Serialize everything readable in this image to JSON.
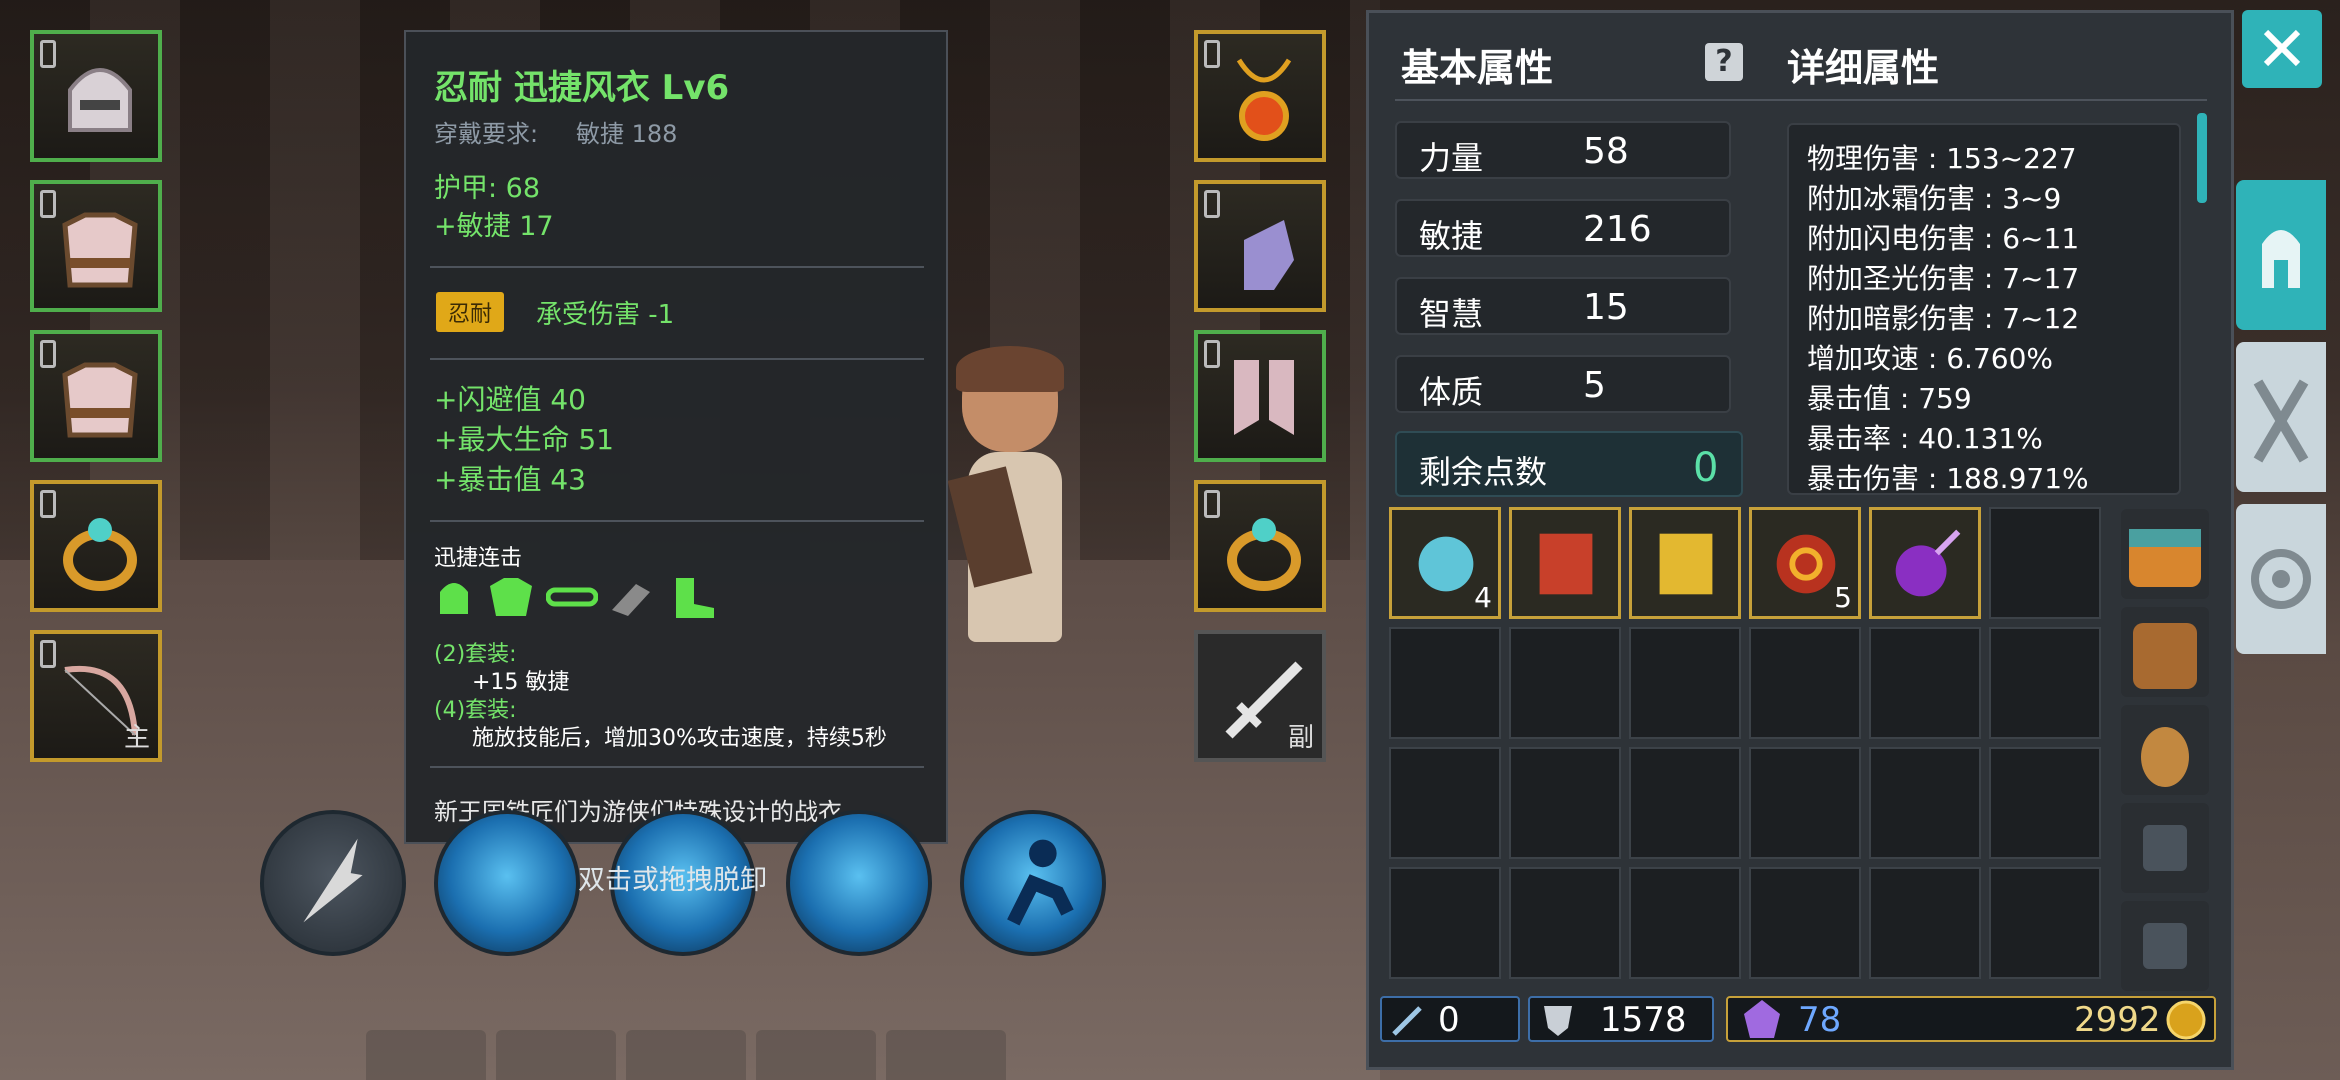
{
  "tooltip": {
    "title": "忍耐 迅捷风衣 Lv6",
    "requirement_label": "穿戴要求:",
    "requirement_value": "敏捷 188",
    "armor": "护甲:  68",
    "agility_bonus": "+敏捷 17",
    "trait_tag": "忍耐",
    "trait_text": "承受伤害 -1",
    "bonuses": [
      "+闪避值 40",
      "+最大生命 51",
      "+暴击值 43"
    ],
    "set_name": "迅捷连击",
    "set2_label": "(2)套装:",
    "set2_text": "+15 敏捷",
    "set4_label": "(4)套装:",
    "set4_text": "施放技能后，增加30%攻击速度，持续5秒",
    "description": "新王国铁匠们为游侠们特殊设计的战衣。"
  },
  "equip_left": [
    {
      "name": "helmet",
      "icon": "helmet-icon"
    },
    {
      "name": "armor",
      "icon": "chest-armor-icon"
    },
    {
      "name": "armor2",
      "icon": "chest-armor-icon"
    },
    {
      "name": "ring",
      "icon": "ring-icon"
    },
    {
      "name": "bow",
      "icon": "bow-icon",
      "tag": "主"
    }
  ],
  "equip_right": [
    {
      "name": "amulet",
      "icon": "amulet-icon"
    },
    {
      "name": "gloves",
      "icon": "gloves-icon"
    },
    {
      "name": "boots",
      "icon": "boots-icon"
    },
    {
      "name": "ring",
      "icon": "ring-icon"
    },
    {
      "name": "offhand",
      "icon": "sword-icon",
      "tag": "副"
    }
  ],
  "hint": "双击或拖拽脱卸",
  "panel": {
    "basic_title": "基本属性",
    "detail_title": "详细属性",
    "stats": [
      {
        "name": "力量",
        "value": "58"
      },
      {
        "name": "敏捷",
        "value": "216"
      },
      {
        "name": "智慧",
        "value": "15"
      },
      {
        "name": "体质",
        "value": "5"
      }
    ],
    "points_label": "剩余点数",
    "points_value": "0",
    "details": [
      "物理伤害 : 153~227",
      "附加冰霜伤害 : 3~9",
      "附加闪电伤害 : 6~11",
      "附加圣光伤害 : 7~17",
      "附加暗影伤害 : 7~12",
      "增加攻速 : 6.760%",
      "暴击值 : 759",
      "暴击率 : 40.131%",
      "暴击伤害 : 188.971%"
    ],
    "inventory": [
      {
        "icon": "ice-golem-icon",
        "count": "4"
      },
      {
        "icon": "scroll-icon",
        "count": ""
      },
      {
        "icon": "scroll-icon",
        "count": ""
      },
      {
        "icon": "shield-spiral-icon",
        "count": "5"
      },
      {
        "icon": "purple-potion-icon",
        "count": ""
      }
    ]
  },
  "resources": {
    "gems": "0",
    "shards": "1578",
    "crystals": "78",
    "gold": "2992"
  },
  "colors": {
    "accent": "#2fb3b8",
    "equip_green": "#4fae4c",
    "equip_gold": "#c39a2c"
  }
}
